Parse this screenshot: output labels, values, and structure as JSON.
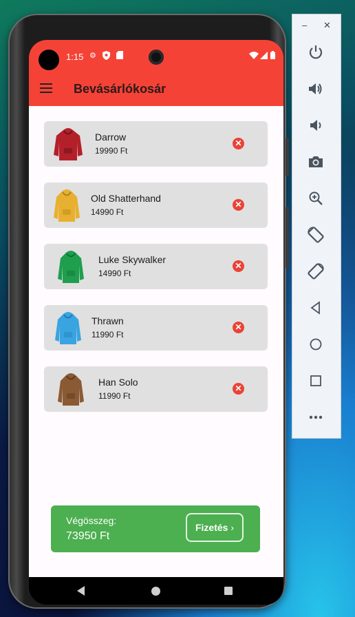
{
  "status_bar": {
    "time": "1:15"
  },
  "app_bar": {
    "title": "Bevásárlókosár",
    "menu_icon": "menu-icon"
  },
  "cart": {
    "items": [
      {
        "name": "Darrow",
        "price": "19990 Ft",
        "color": "#b3202a"
      },
      {
        "name": "Old Shatterhand",
        "price": "14990 Ft",
        "color": "#e8b030"
      },
      {
        "name": "Luke Skywalker",
        "price": "14990 Ft",
        "color": "#1f9e4e"
      },
      {
        "name": "Thrawn",
        "price": "11990 Ft",
        "color": "#3aa4e0"
      },
      {
        "name": "Han Solo",
        "price": "11990 Ft",
        "color": "#8a5a34"
      }
    ]
  },
  "footer": {
    "total_label": "Végösszeg:",
    "total_value": "73950 Ft",
    "pay_button": "Fizetés"
  },
  "colors": {
    "app_bar": "#f44336",
    "card": "#e0e0e0",
    "remove": "#ea4335",
    "total_bar": "#4caf50"
  },
  "emulator_toolbar": {
    "icons": [
      "power-icon",
      "volume-up-icon",
      "volume-down-icon",
      "camera-icon",
      "zoom-in-icon",
      "rotate-left-icon",
      "rotate-right-icon",
      "back-icon",
      "home-icon",
      "overview-icon",
      "more-icon"
    ]
  }
}
